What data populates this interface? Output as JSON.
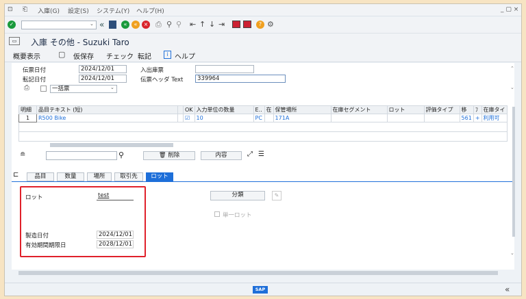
{
  "menu": {
    "items": [
      "入庫(G)",
      "設定(S)",
      "システム(Y)",
      "ヘルプ(H)"
    ]
  },
  "window": {
    "title": "入庫 その他 - Suzuki Taro",
    "controls": "_ ▢ ×"
  },
  "toolbar": {
    "command_field": ""
  },
  "app_toolbar": {
    "items": [
      "概要表示",
      "仮保存",
      "チェック",
      "転記",
      "ヘルプ"
    ]
  },
  "header": {
    "doc_date_label": "伝票日付",
    "doc_date": "2024/12/01",
    "post_date_label": "転記日付",
    "post_date": "2024/12/01",
    "receipt_label": "入出庫票",
    "receipt_value": "",
    "header_text_label": "伝票ヘッダ Text",
    "header_text": "339964",
    "print_option": "一括票"
  },
  "grid": {
    "headers": [
      "明細",
      "品目テキスト (短)",
      "",
      "OK",
      "入力単位の数量",
      "E..",
      "在",
      "保管場所",
      "在庫セグメント",
      "ロット",
      "評価タイプ",
      "移",
      "ﾌ",
      "在庫タイ"
    ],
    "row": {
      "item": "1",
      "text": "R500 Bike",
      "qty": "10",
      "unit": "PC",
      "sloc": "171A",
      "mvt": "561",
      "plus": "+",
      "stocktype": "利用可"
    }
  },
  "grid_toolbar": {
    "delete": "削除",
    "contents": "内容"
  },
  "tabs": [
    "品目",
    "数量",
    "場所",
    "取引先",
    "ロット"
  ],
  "batch": {
    "lot_label": "ロット",
    "lot_value": "test",
    "mfg_date_label": "製造日付",
    "mfg_date": "2024/12/01",
    "expiry_label": "有効期間期限日",
    "expiry": "2028/12/01",
    "classify_button": "分類",
    "single_lot": "単一ロット"
  },
  "status": {
    "logo": "SAP"
  },
  "colors": {
    "accent": "#1e6fd9",
    "highlight": "#e0202a"
  }
}
